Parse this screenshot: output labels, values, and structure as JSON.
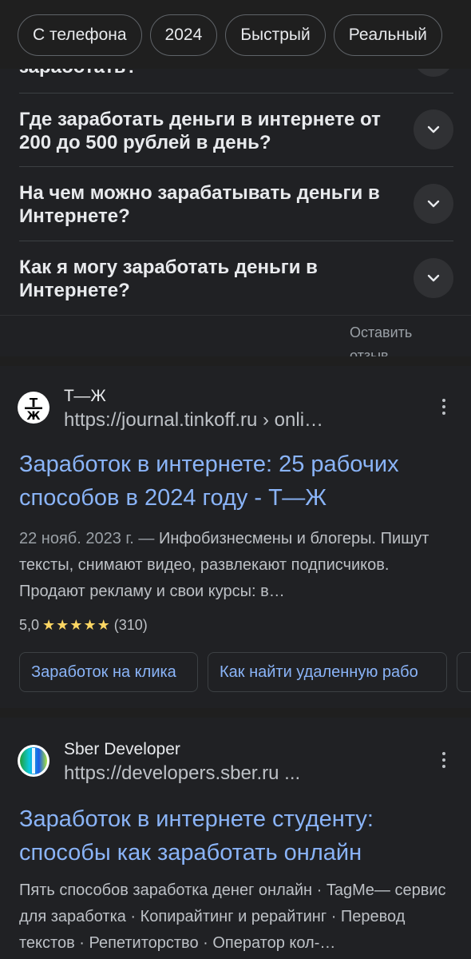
{
  "chips": [
    "С телефона",
    "2024",
    "Быстрый",
    "Реальный"
  ],
  "faq": {
    "clipped_question": "заработать?",
    "questions": [
      "Где заработать деньги в интернете от 200 до 500 рублей в день?",
      "На чем можно зарабатывать деньги в Интернете?",
      "Как я могу заработать деньги в Интернете?"
    ],
    "feedback": "Оставить отзыв"
  },
  "results": [
    {
      "site_name": "Т—Ж",
      "url": "https://journal.tinkoff.ru › onli…",
      "title": "Заработок в интернете: 25 рабочих способов в 2024 году - Т—Ж",
      "date": "22 нояб. 2023 г. —",
      "snippet": "Инфобизнесмены и блогеры. Пишут тексты, снимают видео, развлекают подписчиков. Продают рекламу и свои курсы: в…",
      "rating": "5,0",
      "stars": "★★★★★",
      "reviews": "(310)",
      "sublinks": [
        "Заработок на клика",
        "Как найти удаленную рабо"
      ]
    },
    {
      "site_name": "Sber Developer",
      "url": "https://developers.sber.ru ...",
      "title": "Заработок в интернете студенту: способы как заработать онлайн",
      "snippet": "Пять способов заработка денег онлайн · TagMe— сервис для заработка · Копирайтинг и рерайтинг · Перевод текстов · Репетиторство · Оператор кол-…"
    }
  ]
}
